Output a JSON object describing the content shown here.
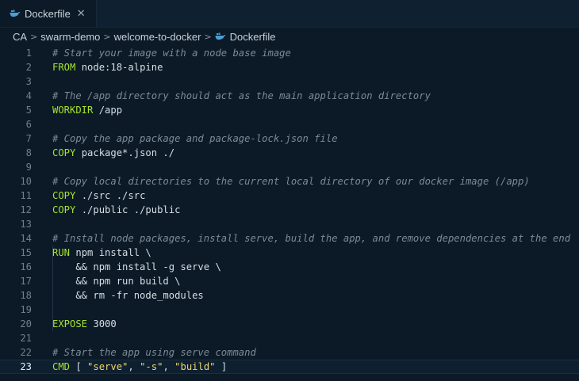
{
  "tab": {
    "label": "Dockerfile",
    "close": "✕"
  },
  "breadcrumb": [
    "CA",
    "swarm-demo",
    "welcome-to-docker",
    "Dockerfile"
  ],
  "colors": {
    "keyword": "#a6e22e",
    "comment": "#7b8a97",
    "string": "#f0d66a",
    "whale_icon": "#4a9fd8"
  },
  "current_line": 23,
  "lines": [
    {
      "n": "1",
      "tokens": [
        {
          "t": "cm",
          "v": "# Start your image with a node base image"
        }
      ]
    },
    {
      "n": "2",
      "tokens": [
        {
          "t": "kw",
          "v": "FROM"
        },
        {
          "t": "txt",
          "v": " node:18-alpine"
        }
      ]
    },
    {
      "n": "3",
      "tokens": []
    },
    {
      "n": "4",
      "tokens": [
        {
          "t": "cm",
          "v": "# The /app directory should act as the main application directory"
        }
      ]
    },
    {
      "n": "5",
      "tokens": [
        {
          "t": "kw",
          "v": "WORKDIR"
        },
        {
          "t": "txt",
          "v": " /app"
        }
      ]
    },
    {
      "n": "6",
      "tokens": []
    },
    {
      "n": "7",
      "tokens": [
        {
          "t": "cm",
          "v": "# Copy the app package and package-lock.json file"
        }
      ]
    },
    {
      "n": "8",
      "tokens": [
        {
          "t": "kw",
          "v": "COPY"
        },
        {
          "t": "txt",
          "v": " package*.json ./"
        }
      ]
    },
    {
      "n": "9",
      "tokens": []
    },
    {
      "n": "10",
      "tokens": [
        {
          "t": "cm",
          "v": "# Copy local directories to the current local directory of our docker image (/app)"
        }
      ]
    },
    {
      "n": "11",
      "tokens": [
        {
          "t": "kw",
          "v": "COPY"
        },
        {
          "t": "txt",
          "v": " ./src ./src"
        }
      ]
    },
    {
      "n": "12",
      "tokens": [
        {
          "t": "kw",
          "v": "COPY"
        },
        {
          "t": "txt",
          "v": " ./public ./public"
        }
      ]
    },
    {
      "n": "13",
      "tokens": []
    },
    {
      "n": "14",
      "tokens": [
        {
          "t": "cm",
          "v": "# Install node packages, install serve, build the app, and remove dependencies at the end"
        }
      ]
    },
    {
      "n": "15",
      "tokens": [
        {
          "t": "kw",
          "v": "RUN"
        },
        {
          "t": "txt",
          "v": " npm install \\"
        }
      ]
    },
    {
      "n": "16",
      "tokens": [
        {
          "t": "txt",
          "v": "    && npm install -g serve \\"
        }
      ]
    },
    {
      "n": "17",
      "tokens": [
        {
          "t": "txt",
          "v": "    && npm run build \\"
        }
      ]
    },
    {
      "n": "18",
      "tokens": [
        {
          "t": "txt",
          "v": "    && rm -fr node_modules"
        }
      ]
    },
    {
      "n": "19",
      "tokens": []
    },
    {
      "n": "20",
      "tokens": [
        {
          "t": "kw",
          "v": "EXPOSE"
        },
        {
          "t": "txt",
          "v": " 3000"
        }
      ]
    },
    {
      "n": "21",
      "tokens": []
    },
    {
      "n": "22",
      "tokens": [
        {
          "t": "cm",
          "v": "# Start the app using serve command"
        }
      ]
    },
    {
      "n": "23",
      "tokens": [
        {
          "t": "kw",
          "v": "CMD"
        },
        {
          "t": "txt",
          "v": " [ "
        },
        {
          "t": "str",
          "v": "\"serve\""
        },
        {
          "t": "txt",
          "v": ", "
        },
        {
          "t": "str",
          "v": "\"-s\""
        },
        {
          "t": "txt",
          "v": ", "
        },
        {
          "t": "str",
          "v": "\"build\""
        },
        {
          "t": "txt",
          "v": " ]"
        }
      ]
    }
  ]
}
